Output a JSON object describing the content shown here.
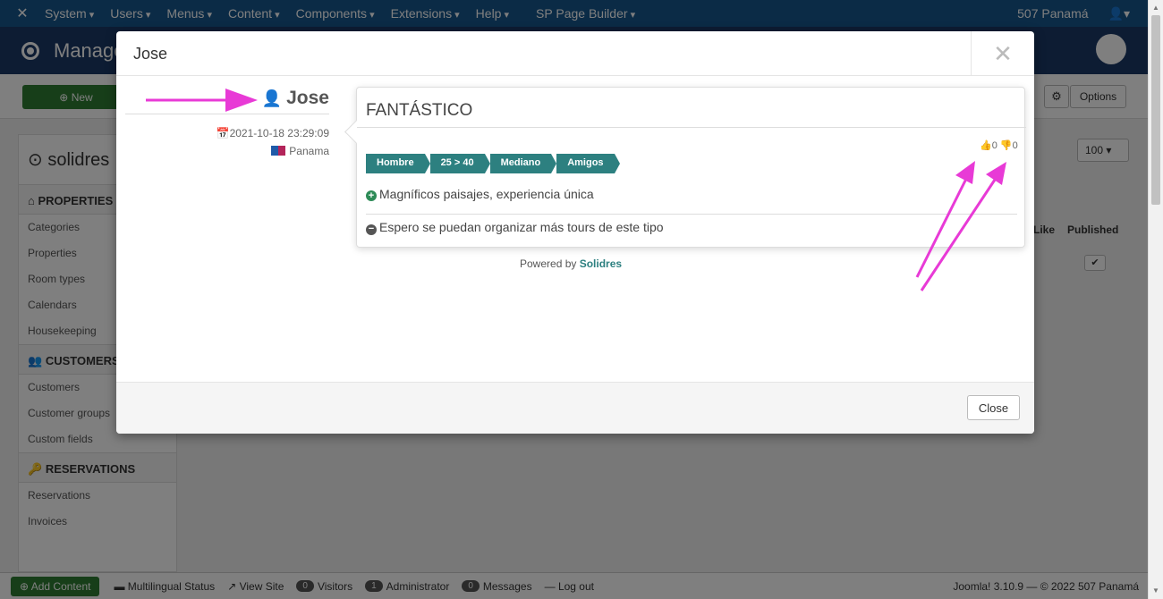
{
  "topnav": {
    "menus": [
      "System",
      "Users",
      "Menus",
      "Content",
      "Components",
      "Extensions",
      "Help",
      "SP Page Builder"
    ],
    "site_name": "507 Panamá",
    "user_icon": "user-icon"
  },
  "header": {
    "title": "Manage"
  },
  "toolbar": {
    "new_label": "New",
    "options_label": "Options"
  },
  "sidebar": {
    "brand": "solidres",
    "sections": [
      {
        "title": "PROPERTIES",
        "icon": "home-icon",
        "items": [
          "Categories",
          "Properties",
          "Room types",
          "Calendars",
          "Housekeeping"
        ]
      },
      {
        "title": "CUSTOMERS",
        "icon": "users-icon",
        "items": [
          "Customers",
          "Customer groups",
          "Custom fields"
        ]
      },
      {
        "title": "RESERVATIONS",
        "icon": "key-icon",
        "items": [
          "Reservations",
          "Invoices"
        ]
      }
    ]
  },
  "content": {
    "like_col": "Like",
    "published_col": "Published",
    "limit_value": "100"
  },
  "statusbar": {
    "add_content": "Add Content",
    "multilingual": "Multilingual Status",
    "view_site": "View Site",
    "visitors_count": "0",
    "visitors": "Visitors",
    "admin_count": "1",
    "administrator": "Administrator",
    "messages_count": "0",
    "messages": "Messages",
    "logout": "Log out",
    "version": "Joomla! 3.10.9 — © 2022 507 Panamá"
  },
  "modal": {
    "title": "Jose",
    "close_label": "Close",
    "review": {
      "reviewer": "Jose",
      "date": "2021-10-18 23:29:09",
      "country": "Panama",
      "title": "FANTÁSTICO",
      "likes": "0",
      "dislikes": "0",
      "tags": [
        "Hombre",
        "25 > 40",
        "Mediano",
        "Amigos"
      ],
      "positive": "Magníficos paisajes, experiencia única",
      "negative": "Espero se puedan organizar más tours de este tipo"
    },
    "powered_prefix": "Powered by",
    "powered_brand": "Solidres"
  },
  "colors": {
    "annotation": "#e83ad6",
    "tag": "#2d8080",
    "nav": "#17568c",
    "header": "#1a3867"
  }
}
